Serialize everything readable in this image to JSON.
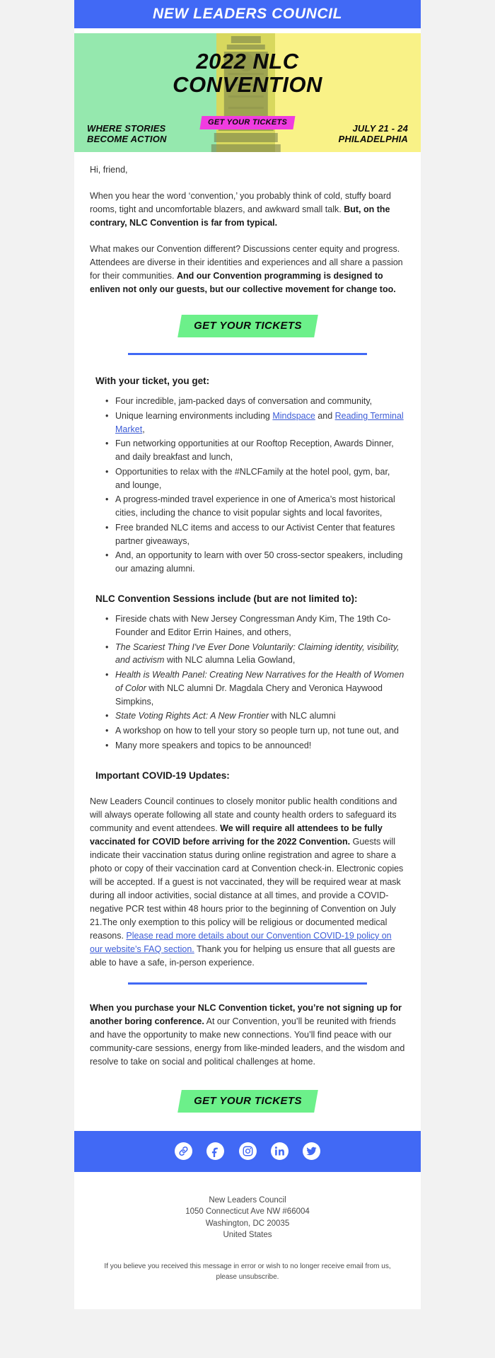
{
  "header": {
    "brand": "NEW LEADERS COUNCIL"
  },
  "hero": {
    "title_line1": "2022 NLC",
    "title_line2": "CONVENTION",
    "tagline_line1": "WHERE STORIES",
    "tagline_line2": "BECOME ACTION",
    "dates_line1": "JULY 21 - 24",
    "dates_line2": "PHILADELPHIA",
    "ticket_label": "GET YOUR TICKETS",
    "colors": {
      "green": "#95e8ae",
      "yellow": "#f9f287",
      "magenta": "#f03ce0"
    }
  },
  "body": {
    "greeting": "Hi, friend,",
    "para1_plain1": "When you hear the word ‘convention,’ you probably think of cold, stuffy board rooms, tight and uncomfortable blazers, and awkward small talk. ",
    "para1_bold": "But, on the contrary, NLC Convention is far from typical.",
    "para2_plain1": "What makes our Convention different? Discussions center equity and progress. Attendees are diverse in their identities and experiences and all share a passion for their communities. ",
    "para2_bold": "And our Convention programming is designed to enliven not only our guests, but our collective movement for change too.",
    "cta1_label": "GET YOUR TICKETS",
    "ticket_heading": "With your ticket, you get:",
    "ticket_items": [
      {
        "pre": "Four incredible, jam-packed days of conversation and community,"
      },
      {
        "pre": "Unique learning environments including ",
        "link1": "Mindspace",
        "mid": " and ",
        "link2": "Reading Terminal Market",
        "post": ","
      },
      {
        "pre": "Fun networking opportunities at our Rooftop Reception, Awards Dinner, and daily breakfast and lunch,"
      },
      {
        "pre": "Opportunities to relax with the #NLCFamily at the hotel pool, gym, bar, and lounge,"
      },
      {
        "pre": "A progress-minded travel experience in one of America’s most historical cities, including the chance to visit popular sights and local favorites,"
      },
      {
        "pre": "Free branded NLC items and access to our Activist Center that features partner giveaways,"
      },
      {
        "pre": "And, an opportunity to learn with over 50 cross-sector speakers, including our amazing alumni."
      }
    ],
    "sessions_heading": "NLC Convention Sessions include (but are not limited to):",
    "sessions_items": [
      {
        "plain": "Fireside chats with New Jersey Congressman Andy Kim, The 19th Co- Founder and Editor Errin Haines, and others,"
      },
      {
        "italic": "The Scariest Thing I've Ever Done Voluntarily: Claiming identity, visibility, and activism",
        "tail": " with NLC alumna Lelia Gowland,"
      },
      {
        "italic": "Health is Wealth Panel: Creating New Narratives for the Health of Women of Color",
        "tail": " with NLC alumni Dr. Magdala Chery and Veronica Haywood Simpkins,"
      },
      {
        "italic": "State Voting Rights Act: A New Frontier",
        "tail": " with NLC alumni"
      },
      {
        "plain": "A workshop on how to tell your story so people turn up, not tune out, and"
      },
      {
        "plain": "Many more speakers and topics to be announced!"
      }
    ],
    "covid_heading": "Important COVID-19 Updates:",
    "covid_p1": "New Leaders Council continues to closely monitor public health conditions and will always operate following all state and county health orders to safeguard its community and event attendees. ",
    "covid_bold": "We will require all attendees to be fully vaccinated for COVID before arriving for the 2022 Convention.",
    "covid_p2": " Guests will indicate their vaccination status during online registration and agree to share a photo or copy of their vaccination card at Convention check-in. Electronic copies will be accepted. If a guest is not vaccinated, they will be required wear at mask during all indoor activities, social distance at all times, and provide a COVID-negative PCR test within 48 hours prior to the beginning of Convention on July 21.The only exemption to this policy will be religious or documented medical reasons. ",
    "covid_link": "Please read more details about our Convention COVID-19 policy on our website’s FAQ section.",
    "covid_p3": " Thank you for helping us ensure that all guests are able to have a safe, in-person experience.",
    "closing_bold": "When you purchase your NLC Convention ticket, you’re not signing up for another boring conference.",
    "closing_plain": " At our Convention, you’ll be reunited with friends and have the opportunity to make new connections. You’ll find peace with our community-care sessions, energy from like-minded leaders, and the wisdom and resolve to take on social and political challenges at home.",
    "cta2_label": "GET YOUR TICKETS"
  },
  "footer": {
    "social": [
      {
        "name": "link-icon",
        "label": "Website"
      },
      {
        "name": "facebook-icon",
        "label": "Facebook"
      },
      {
        "name": "instagram-icon",
        "label": "Instagram"
      },
      {
        "name": "linkedin-icon",
        "label": "LinkedIn"
      },
      {
        "name": "twitter-icon",
        "label": "Twitter"
      }
    ],
    "address": [
      "New Leaders Council",
      "1050 Connecticut Ave NW #66004",
      "Washington, DC 20035",
      "United States"
    ],
    "unsubscribe_text": "If you believe you received this message in error or wish to no longer receive email from us, please unsubscribe.",
    "brand_color": "#4169f5"
  }
}
